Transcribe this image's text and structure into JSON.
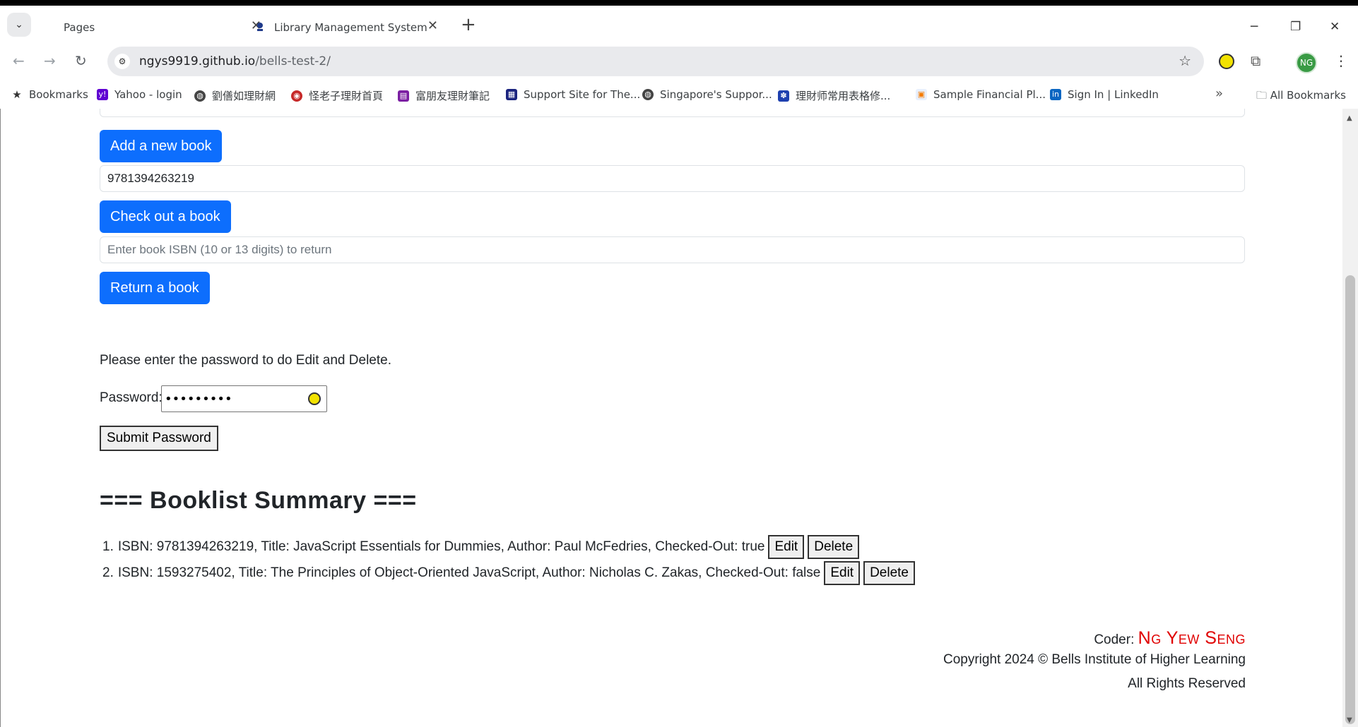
{
  "browser": {
    "tabs": [
      {
        "label": "Pages"
      },
      {
        "label": "Library Management System"
      }
    ],
    "url_host": "ngys9919.github.io",
    "url_path": "/bells-test-2/",
    "profile_initials": "NG",
    "bookmarks": [
      {
        "label": "Bookmarks",
        "icon": "star-icon"
      },
      {
        "label": "Yahoo - login",
        "icon": "yahoo-icon",
        "color": "#6001d2"
      },
      {
        "label": "劉僐如理財網",
        "icon": "globe-icon"
      },
      {
        "label": "怪老子理財首頁",
        "icon": "flame-icon"
      },
      {
        "label": "富朋友理財筆記",
        "icon": "notebook-icon",
        "color": "#7b1fa2"
      },
      {
        "label": "Support Site for The...",
        "icon": "grid-icon",
        "color": "#1a237e"
      },
      {
        "label": "Singapore's Suppor...",
        "icon": "globe-icon"
      },
      {
        "label": "理財师常用表格修...",
        "icon": "paw-icon",
        "color": "#1e40af"
      },
      {
        "label": "Sample Financial Pl...",
        "icon": "doc-icon"
      },
      {
        "label": "Sign In | LinkedIn",
        "icon": "linkedin-icon",
        "color": "#0a66c2"
      }
    ],
    "all_bookmarks_label": "All Bookmarks"
  },
  "page": {
    "add_book_button": "Add a new book",
    "checkout_input_value": "9781394263219",
    "checkout_button": "Check out a book",
    "return_input_placeholder": "Enter book ISBN (10 or 13 digits) to return",
    "return_button": "Return a book",
    "password_note": "Please enter the password to do Edit and Delete.",
    "password_label": "Password:",
    "password_value": "•••••••••",
    "submit_password_button": "Submit Password",
    "summary_heading": "=== Booklist Summary ===",
    "books": [
      {
        "num": "1.",
        "text": "ISBN: 9781394263219, Title: JavaScript Essentials for Dummies, Author: Paul McFedries, Checked-Out: true",
        "edit_label": "Edit",
        "delete_label": "Delete"
      },
      {
        "num": "2.",
        "text": "ISBN: 1593275402, Title: The Principles of Object-Oriented JavaScript, Author: Nicholas C. Zakas, Checked-Out: false",
        "edit_label": "Edit",
        "delete_label": "Delete"
      }
    ],
    "footer": {
      "coder_label": "Coder:",
      "coder_name": "Ng Yew Seng",
      "copyright": "Copyright 2024 © Bells Institute of Higher Learning",
      "rights": "All Rights Reserved"
    }
  },
  "colors": {
    "primary": "#0d6efd",
    "coder_name": "#e00000"
  }
}
